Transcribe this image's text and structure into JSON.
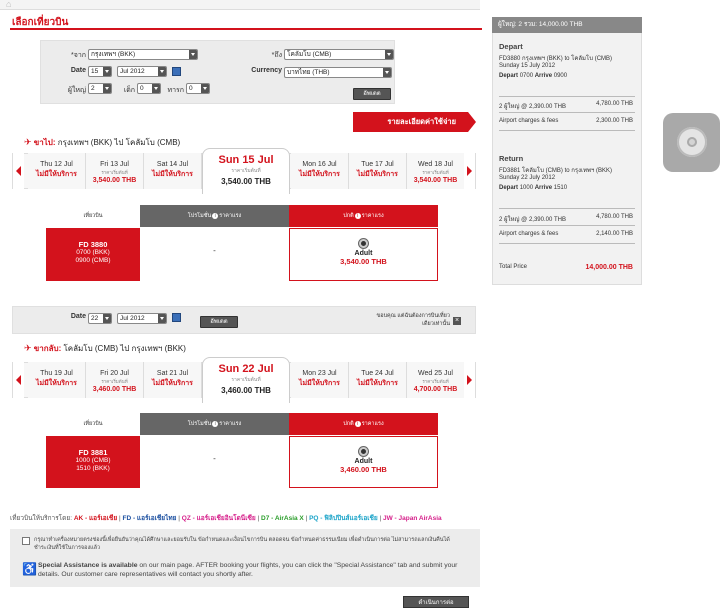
{
  "page": {
    "title": "เลือกเที่ยวบิน"
  },
  "search": {
    "from_label": "*จาก",
    "from_value": "กรุงเทพฯ (BKK)",
    "to_label": "*ถึง",
    "to_value": "โคลัมโบ (CMB)",
    "date_label": "Date",
    "date_day": "15",
    "date_month": "Jul 2012",
    "currency_label": "Currency",
    "currency_value": "บาทไทย (THB)",
    "adult_label": "ผู้ใหญ่",
    "adult_value": "2",
    "child_label": "เด็ก",
    "child_value": "0",
    "infant_label": "ทารก",
    "infant_value": "0",
    "update_button": "อัพเดต"
  },
  "summary_button": "รายละเอียดค่าใช้จ่าย",
  "depart_section": {
    "prefix": "ขาไป:",
    "route": "กรุงเทพฯ (BKK)  ไป  โคลัมโบ (CMB)",
    "days": [
      {
        "date": "Thu 12 Jul",
        "sub": "",
        "price": "ไม่มีให้บริการ"
      },
      {
        "date": "Fri 13 Jul",
        "sub": "ราคาเริ่มต้นที่",
        "price": "3,540.00 THB"
      },
      {
        "date": "Sat 14 Jul",
        "sub": "",
        "price": "ไม่มีให้บริการ"
      },
      {
        "date": "Sun 15 Jul",
        "sub": "ราคาเริ่มต้นที่",
        "price": "3,540.00 THB"
      },
      {
        "date": "Mon 16 Jul",
        "sub": "",
        "price": "ไม่มีให้บริการ"
      },
      {
        "date": "Tue 17 Jul",
        "sub": "",
        "price": "ไม่มีให้บริการ"
      },
      {
        "date": "Wed 18 Jul",
        "sub": "ราคาเริ่มต้นที่",
        "price": "3,540.00 THB"
      }
    ],
    "col_flight": "เที่ยวบิน",
    "col_promo": "โปรโมชั่น",
    "col_low": "ปกติ",
    "col_suffix": "ราคาแรง",
    "flight_no": "FD  3880",
    "depart_time": "0700  (BKK)",
    "arrive_time": "0900  (CMB)",
    "promo_value": "-",
    "fare_label": "Adult",
    "fare_price": "3,540.00 THB"
  },
  "return_search": {
    "date_label": "Date",
    "date_day": "22",
    "date_month": "Jul 2012",
    "update_button": "อัพเดต",
    "oneway_note_1": "ขอบคุณ แต่ฉันต้องการบินเที่ยว",
    "oneway_note_2": "เดียวเท่านั้น"
  },
  "return_section": {
    "prefix": "ขากลับ:",
    "route": "โคลัมโบ (CMB)  ไป  กรุงเทพฯ (BKK)",
    "days": [
      {
        "date": "Thu 19 Jul",
        "sub": "",
        "price": "ไม่มีให้บริการ"
      },
      {
        "date": "Fri 20 Jul",
        "sub": "ราคาเริ่มต้นที่",
        "price": "3,460.00 THB"
      },
      {
        "date": "Sat 21 Jul",
        "sub": "",
        "price": "ไม่มีให้บริการ"
      },
      {
        "date": "Sun 22 Jul",
        "sub": "ราคาเริ่มต้นที่",
        "price": "3,460.00 THB"
      },
      {
        "date": "Mon 23 Jul",
        "sub": "",
        "price": "ไม่มีให้บริการ"
      },
      {
        "date": "Tue 24 Jul",
        "sub": "",
        "price": "ไม่มีให้บริการ"
      },
      {
        "date": "Wed 25 Jul",
        "sub": "ราคาเริ่มต้นที่",
        "price": "4,700.00 THB"
      }
    ],
    "col_flight": "เที่ยวบิน",
    "col_promo": "โปรโมชั่น",
    "col_low": "ปกติ",
    "col_suffix": "ราคาแรง",
    "flight_no": "FD  3881",
    "depart_time": "1000  (CMB)",
    "arrive_time": "1510  (BKK)",
    "promo_value": "-",
    "fare_label": "Adult",
    "fare_price": "3,460.00 THB"
  },
  "sidebar": {
    "header": "ผู้ใหญ่: 2  รวม: 14,000.00 THB",
    "depart_title": "Depart",
    "depart_line1": "FD3880 กรุงเทพฯ (BKK) to โคลัมโบ (CMB)",
    "depart_line2": "Sunday 15 July 2012",
    "depart_line3_a": "Depart",
    "depart_line3_b": "0700",
    "depart_line3_c": "Arrive",
    "depart_line3_d": "0900",
    "depart_fare_label": "2 ผู้ใหญ่ @ 2,390.00 THB",
    "depart_fare_value": "4,780.00 THB",
    "depart_fee_label": "Airport charges & fees",
    "depart_fee_value": "2,300.00 THB",
    "return_title": "Return",
    "return_line1": "FD3881 โคลัมโบ (CMB) to กรุงเทพฯ (BKK)",
    "return_line2": "Sunday 22 July 2012",
    "return_line3_a": "Depart",
    "return_line3_b": "1000",
    "return_line3_c": "Arrive",
    "return_line3_d": "1510",
    "return_fare_label": "2 ผู้ใหญ่ @ 2,390.00 THB",
    "return_fare_value": "4,780.00 THB",
    "return_fee_label": "Airport charges & fees",
    "return_fee_value": "2,140.00 THB",
    "total_label": "Total Price",
    "total_value": "14,000.00 THB"
  },
  "legend": {
    "intro": "เที่ยวบินให้บริการโดย:",
    "ak": "AK - แอร์เอเชีย",
    "fd": "FD - แอร์เอเชียไทย",
    "qz": "QZ - แอร์เอเชียอินโดนีเซีย",
    "d7": "D7 - AirAsia X",
    "pq": "PQ - ฟิลิปปินส์แอร์เอเชีย",
    "jw": "JW - Japan AirAsia",
    "sep": "|"
  },
  "terms": {
    "line1": "กรุณาทำเครื่องหมายตรงช่องนี้เพื่อยืนยันว่าคุณได้ศึกษาและยอมรับใน ข้อกำหนดและเงื่อนไขการบิน ตลอดจน ข้อกำหนดค่าธรรมเนียม เพื่อดำเนินการต่อ ไม่สามารถแลกเงินคืนได้",
    "line2": "ชำระเงินที่ใช้ในการจองแล้ว",
    "assist_bold": "Special Assistance is available",
    "assist_text1": " on our main page. AFTER booking your flights, you can click the \"Special Assistance\" tab and submit your",
    "assist_text2": "details. Our customer care representatives will contact you shortly after."
  },
  "continue_button": "ดำเนินการต่อ",
  "colors": {
    "brand_red": "#d3121c",
    "legend_green": "#2a9d2a",
    "legend_blue": "#1b4fa0",
    "legend_pink": "#d61f8a",
    "legend_cyan": "#1aa3c8"
  }
}
